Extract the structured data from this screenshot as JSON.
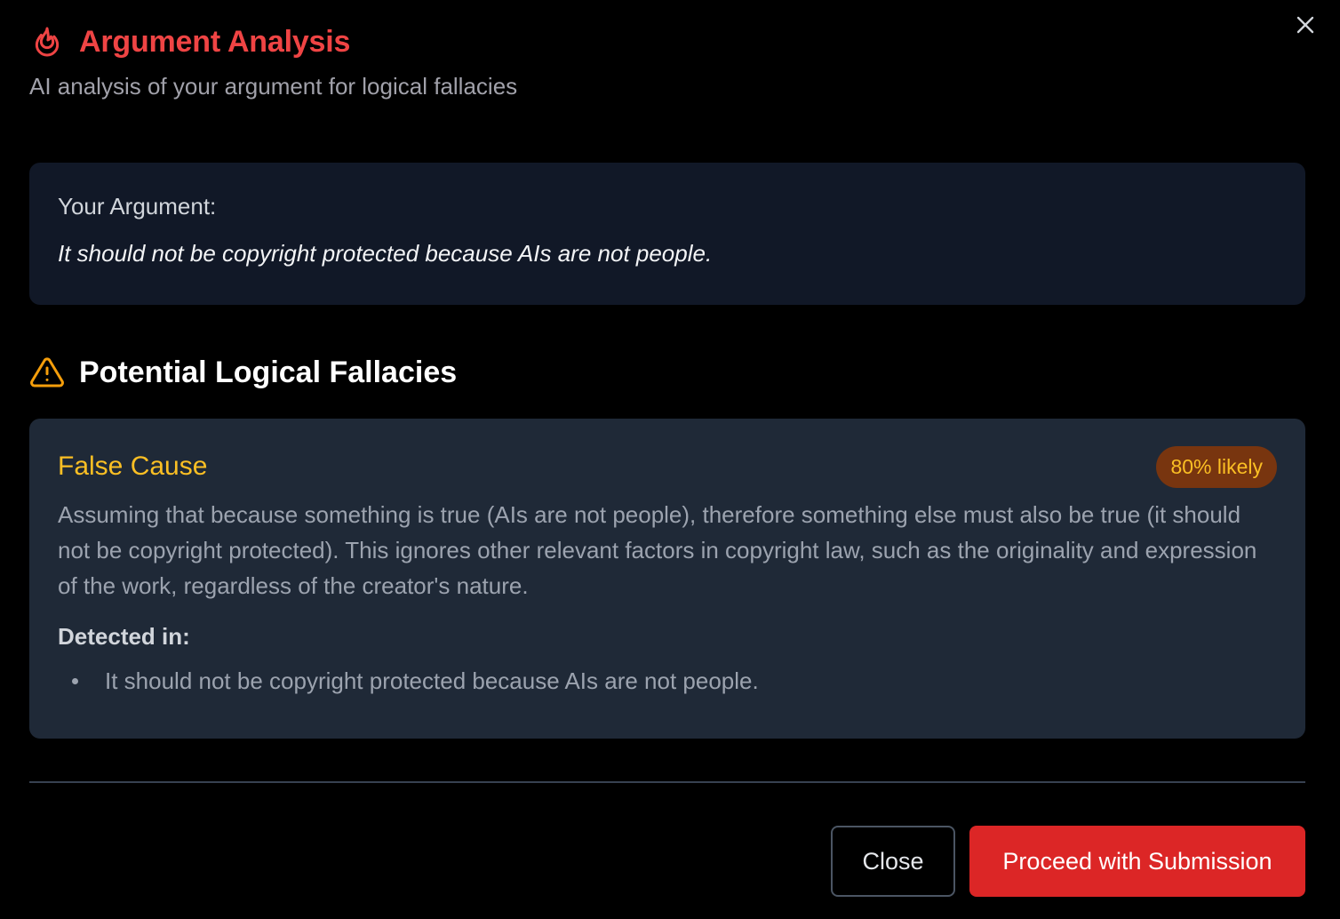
{
  "dialog": {
    "title": "Argument Analysis",
    "subtitle": "AI analysis of your argument for logical fallacies",
    "close_icon": "close-icon",
    "title_icon": "flame-icon",
    "accent_color": "#ef4444"
  },
  "argument": {
    "label": "Your Argument:",
    "text": "It should not be copyright protected because AIs are not people."
  },
  "fallacies_section": {
    "heading": "Potential Logical Fallacies",
    "icon": "warning-icon",
    "icon_color": "#f59e0b"
  },
  "fallacies": [
    {
      "name": "False Cause",
      "likelihood_label": "80% likely",
      "likelihood": 0.8,
      "description": "Assuming that because something is true (AIs are not people), therefore something else must also be true (it should not be copyright protected). This ignores other relevant factors in copyright law, such as the originality and expression of the work, regardless of the creator's nature.",
      "detected_label": "Detected in:",
      "detected_in": [
        "It should not be copyright protected because AIs are not people."
      ]
    }
  ],
  "footer": {
    "close_label": "Close",
    "proceed_label": "Proceed with Submission",
    "proceed_color": "#dc2626"
  }
}
